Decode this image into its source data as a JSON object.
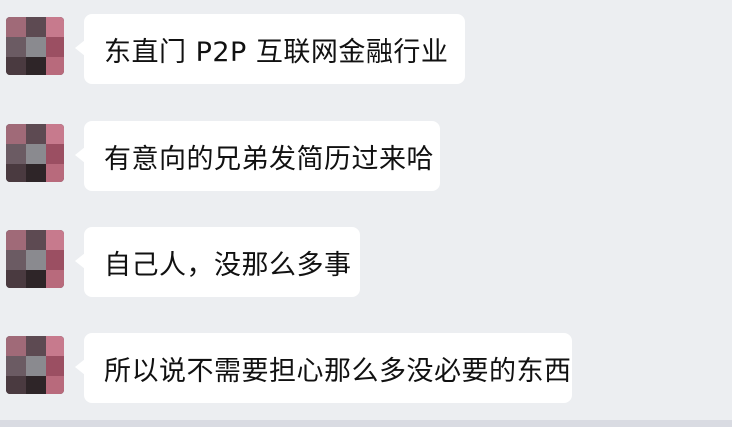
{
  "messages": [
    {
      "text": "东直门   P2P 互联网金融行业"
    },
    {
      "text": "有意向的兄弟发简历过来哈"
    },
    {
      "text": "自己人，没那么多事"
    },
    {
      "text": "所以说不需要担心那么多没必要的东西"
    }
  ],
  "colors": {
    "background": "#eceef1",
    "bubble": "#ffffff",
    "text": "#111111"
  }
}
